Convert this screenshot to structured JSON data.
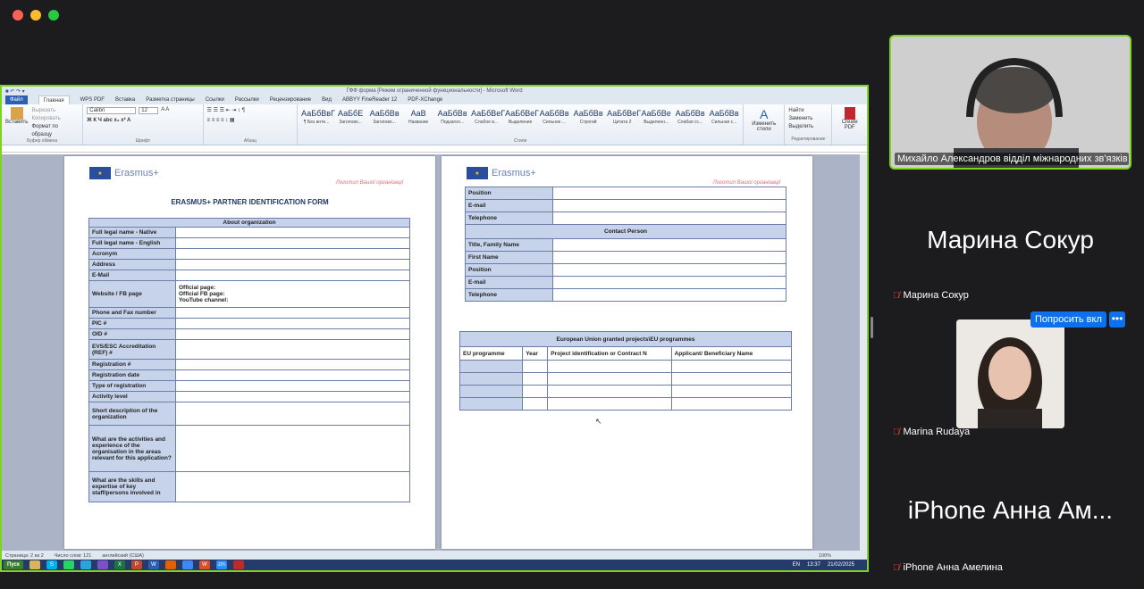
{
  "word": {
    "title_bar": "ГФФ форма [Режим ограниченной функциональности] - Microsoft Word",
    "tabs": [
      "Файл",
      "Главная",
      "WPS PDF",
      "Вставка",
      "Разметка страницы",
      "Ссылки",
      "Рассылки",
      "Рецензирование",
      "Вид",
      "ABBYY FineReader 12",
      "PDF-XChange"
    ],
    "ribbon": {
      "clipboard_items": [
        "Вставить",
        "Вырезать",
        "Копировать",
        "Формат по образцу"
      ],
      "clipboard_label": "Буфер обмена",
      "font_name": "Calibri",
      "font_size": "12",
      "font_label": "Шрифт",
      "paragraph_label": "Абзац",
      "styles_label": "Стили",
      "styles": [
        {
          "sample": "АаБбВвГ",
          "name": "¶ Без инте..."
        },
        {
          "sample": "АаБбЕ",
          "name": "Заголово..."
        },
        {
          "sample": "АаБбВв",
          "name": "Заголово..."
        },
        {
          "sample": "АаВ",
          "name": "Название"
        },
        {
          "sample": "АаБбВв",
          "name": "Подзагол..."
        },
        {
          "sample": "АаБбВеГ",
          "name": "Слабое в..."
        },
        {
          "sample": "АаБбВеГ",
          "name": "Выделение"
        },
        {
          "sample": "АаБбВв",
          "name": "Сильное ..."
        },
        {
          "sample": "АаБбВв",
          "name": "Строгий"
        },
        {
          "sample": "АаБбВеГ",
          "name": "Цитата 2"
        },
        {
          "sample": "АаБбВе",
          "name": "Выделенн..."
        },
        {
          "sample": "АаБбВв",
          "name": "Слабая сс..."
        },
        {
          "sample": "АаБбВв",
          "name": "Сильная с..."
        }
      ],
      "change_styles": "Изменить стили",
      "editing_items": [
        "Найти",
        "Заменить",
        "Выделить"
      ],
      "editing_label": "Редактирование",
      "create_pdf": "Create PDF"
    },
    "page1": {
      "logo": "Erasmus+",
      "placeholder": "Логотип Вашої організації",
      "title": "ERASMUS+ PARTNER IDENTIFICATION FORM",
      "section_head": "About organization",
      "rows": [
        {
          "label": "Full legal name - Native",
          "value": ""
        },
        {
          "label": "Full legal name - English",
          "value": ""
        },
        {
          "label": "Acronym",
          "value": ""
        },
        {
          "label": "Address",
          "value": ""
        },
        {
          "label": "E-Mail",
          "value": ""
        },
        {
          "label": "Website / FB page",
          "value": "Official page:\nOfficial FB page:\nYouTube channel:"
        },
        {
          "label": "Phone and Fax number",
          "value": ""
        },
        {
          "label": "PIC #",
          "value": ""
        },
        {
          "label": "OID #",
          "value": ""
        },
        {
          "label": "EVS/ESC Accreditation (REF) #",
          "value": ""
        },
        {
          "label": "Registration #",
          "value": ""
        },
        {
          "label": "Registration date",
          "value": ""
        },
        {
          "label": "Type of registration",
          "value": ""
        },
        {
          "label": "Activity level",
          "value": ""
        },
        {
          "label": "Short description of the organization",
          "value": ""
        },
        {
          "label": "What are the activities and experience of the organisation in the areas relevant for this application?",
          "value": ""
        },
        {
          "label": "What are the skills and expertise of key staff/persons involved in",
          "value": ""
        }
      ]
    },
    "page2": {
      "logo": "Erasmus+",
      "placeholder": "Логотип Вашої організації",
      "top_rows": [
        "Position",
        "E-mail",
        "Telephone"
      ],
      "contact_head": "Contact Person",
      "contact_rows": [
        "Title, Family Name",
        "First Name",
        "Position",
        "E-mail",
        "Telephone"
      ],
      "eu_head": "European Union granted projects\\EU programmes",
      "eu_columns": [
        "EU programme",
        "Year",
        "Project identification or Contract N",
        "Applicant/ Beneficiary Name"
      ]
    },
    "status": {
      "pages": "Страница: 2 из 2",
      "words": "Число слов: 121",
      "lang": "английский (США)",
      "zoom": "100%"
    },
    "taskbar": {
      "start": "Пуск",
      "lang": "EN",
      "time": "13:37",
      "date": "21/02/2025"
    }
  },
  "participants": [
    {
      "name": "Михайло Александров відділ міжнародних зв'язків",
      "has_video": true
    },
    {
      "name": "Марина Сокур",
      "has_video": false,
      "muted": true
    },
    {
      "name": "Marina Rudaya",
      "has_video": true,
      "muted": true
    },
    {
      "name": "iPhone Анна Амелина",
      "display_short": "iPhone Анна Ам...",
      "has_video": false,
      "muted": true
    }
  ],
  "controls": {
    "ask_unmute": "Попросить вкл",
    "more": "•••"
  },
  "colors": {
    "active_speaker": "#7ed321",
    "zoom_blue": "#0e71eb",
    "table_header": "#c6d3ea"
  }
}
